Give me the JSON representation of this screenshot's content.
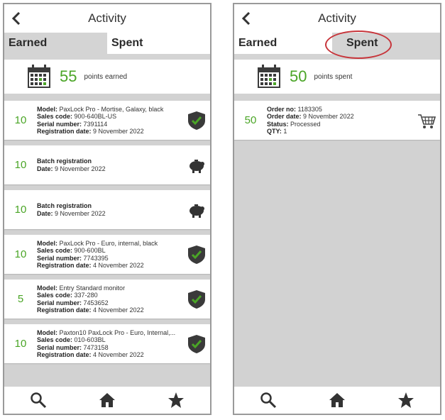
{
  "header": {
    "title": "Activity"
  },
  "tabs": {
    "earned": "Earned",
    "spent": "Spent"
  },
  "left": {
    "summary": {
      "points": "55",
      "label": "points earned"
    },
    "items": [
      {
        "points": "10",
        "l1k": "Model:",
        "l1v": "PaxLock Pro - Mortise, Galaxy, black",
        "l2k": "Sales code:",
        "l2v": "900-640BL-US",
        "l3k": "Serial number:",
        "l3v": "7391114",
        "l4k": "Registration date:",
        "l4v": "9 November 2022",
        "icon": "shield-check-icon"
      },
      {
        "points": "10",
        "l1k": "Batch registration",
        "l1v": "",
        "l2k": "Date:",
        "l2v": "9 November 2022",
        "l3k": "",
        "l3v": "",
        "l4k": "",
        "l4v": "",
        "icon": "piggy-bank-icon"
      },
      {
        "points": "10",
        "l1k": "Batch registration",
        "l1v": "",
        "l2k": "Date:",
        "l2v": "9 November 2022",
        "l3k": "",
        "l3v": "",
        "l4k": "",
        "l4v": "",
        "icon": "piggy-bank-icon"
      },
      {
        "points": "10",
        "l1k": "Model:",
        "l1v": "PaxLock Pro - Euro, internal, black",
        "l2k": "Sales code:",
        "l2v": "900-600BL",
        "l3k": "Serial number:",
        "l3v": "7743395",
        "l4k": "Registration date:",
        "l4v": "4 November 2022",
        "icon": "shield-check-icon"
      },
      {
        "points": "5",
        "l1k": "Model:",
        "l1v": "Entry Standard monitor",
        "l2k": "Sales code:",
        "l2v": "337-280",
        "l3k": "Serial number:",
        "l3v": "7453652",
        "l4k": "Registration date:",
        "l4v": "4 November 2022",
        "icon": "shield-check-icon"
      },
      {
        "points": "10",
        "l1k": "Model:",
        "l1v": "Paxton10 PaxLock Pro - Euro, Internal,...",
        "l2k": "Sales code:",
        "l2v": "010-603BL",
        "l3k": "Serial number:",
        "l3v": "7473158",
        "l4k": "Registration date:",
        "l4v": "4 November 2022",
        "icon": "shield-check-icon"
      }
    ]
  },
  "right": {
    "summary": {
      "points": "50",
      "label": "points spent"
    },
    "items": [
      {
        "points": "50",
        "l1k": "Order no:",
        "l1v": "1183305",
        "l2k": "Order date:",
        "l2v": "9 November 2022",
        "l3k": "Status:",
        "l3v": "Processed",
        "l4k": "QTY:",
        "l4v": "1",
        "icon": "shopping-cart-icon"
      }
    ]
  },
  "nav": {
    "icons": [
      "search-icon",
      "home-icon",
      "star-icon"
    ]
  },
  "colors": {
    "accent_green": "#4aa526",
    "highlight_red": "#c7343a"
  }
}
